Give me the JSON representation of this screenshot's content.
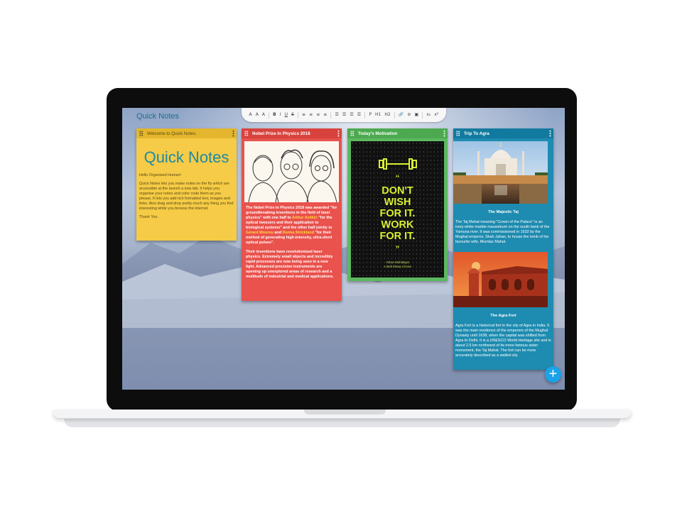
{
  "app": {
    "title": "Quick Notes"
  },
  "toolbar": {
    "buttons": [
      "A",
      "A",
      "A",
      "B",
      "I",
      "U",
      "S",
      "≡",
      "≡",
      "≡",
      "≡",
      "☰",
      "☰",
      "☰",
      "☰",
      "P",
      "H1",
      "H2",
      "🔗",
      "⊘",
      "▣",
      "x₂",
      "x²"
    ]
  },
  "notes": {
    "welcome": {
      "title": "Welcome to Quick Notes.",
      "heading": "Quick Notes",
      "paragraphs": [
        "Hello Organised Human!",
        "Quick Notes lets you make notes on the fly which are accessible at the launch a new tab. It helps you organise your notes and color code them as you please. It lets you add rich formatted text, images and links. Also drag and drop pretty much any thing you find interesting while you browse the internet.",
        "Thank You."
      ],
      "color": "#f5cb47"
    },
    "nobel": {
      "title": "Nobel Prize In Physics 2018",
      "p1": {
        "t1": "The Nobel Prize in Physics 2018 was awarded \"for groundbreaking inventions in the field of laser physics\" with one half to ",
        "name1": "Arthur Ashkin",
        "t2": " \"for the optical tweezers and their application to biological systems\" and the other half jointly to ",
        "name2": "Gérard Mourou",
        "t3": " and ",
        "name3": "Donna Strickland",
        "t4": " \"for their method of generating high-intensity, ultra-short optical pulses\"."
      },
      "p2": "Their inventions have revolutionised laser physics. Extremely small objects and incredibly rapid processes are now being seen in a new light. Advanced precision instruments are opening up unexplored areas of research and a multitude of industrial and medical applications.",
      "color": "#e9524d"
    },
    "motivation": {
      "title": "Today's Motivation",
      "quote_lines": [
        "DON'T",
        "WISH",
        "FOR IT.",
        "WORK",
        "FOR IT."
      ],
      "credit_line1": "Yohan Wuhidayat",
      "credit_line2": "A Wall Sheep Choice",
      "accent_color": "#d9f031",
      "color": "#5cb95f"
    },
    "agra": {
      "title": "Trip To Agra",
      "caption1": "The Majestic Taj",
      "text1": "The Taj Mahal meaning \"Crown of the Palace\" is an ivory-white marble mausoleum on the south bank of the Yamuna river. It was commissioned in 1632 by the Mughal emperor, Shah Jahan, to house the tomb of his favourite wife, Mumtaz Mahal.",
      "caption2": "The Agra Fort",
      "text2": "Agra Fort is a historical fort in the city of Agra in India. It was the main residence of the emperors of the Mughal Dynasty until 1638, when the capital was shifted from Agra to Delhi. It is a UNESCO World Heritage site and is about 2.5 km northwest of its more famous sister monument, the Taj Mahal. The fort can be more accurately described as a walled city.",
      "color": "#1e8bb0"
    }
  },
  "fab": {
    "label": "+"
  }
}
